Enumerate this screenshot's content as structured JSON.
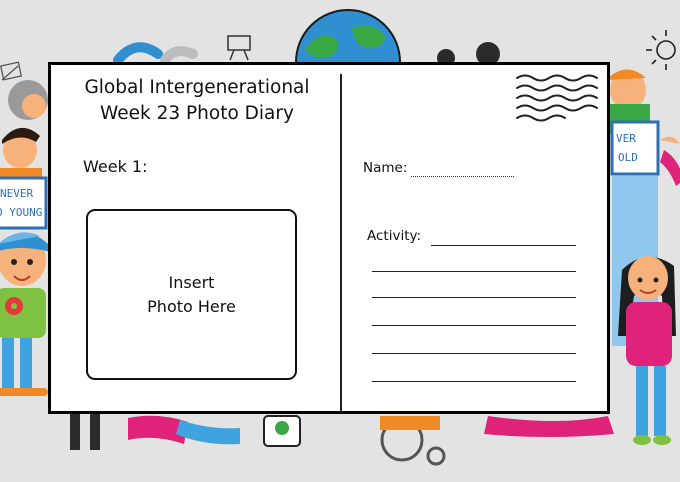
{
  "card": {
    "title_line1": "Global Intergenerational",
    "title_line2": "Week 23 Photo Diary",
    "week_label": "Week 1:",
    "photo_line1": "Insert",
    "photo_line2": "Photo Here",
    "name_label": "Name:",
    "activity_label": "Activity:"
  },
  "background": {
    "sign_left_line1": "NEVER",
    "sign_left_line2": "O YOUNG",
    "sign_right_line1": "VER",
    "sign_right_line2": "OLD"
  },
  "colors": {
    "card_border": "#000000",
    "background": "#e3e3e3",
    "ocean": "#2f8fd0",
    "land": "#3aa845",
    "pink": "#e0237a",
    "green_shirt": "#7fc241",
    "skin": "#f6b27a"
  }
}
